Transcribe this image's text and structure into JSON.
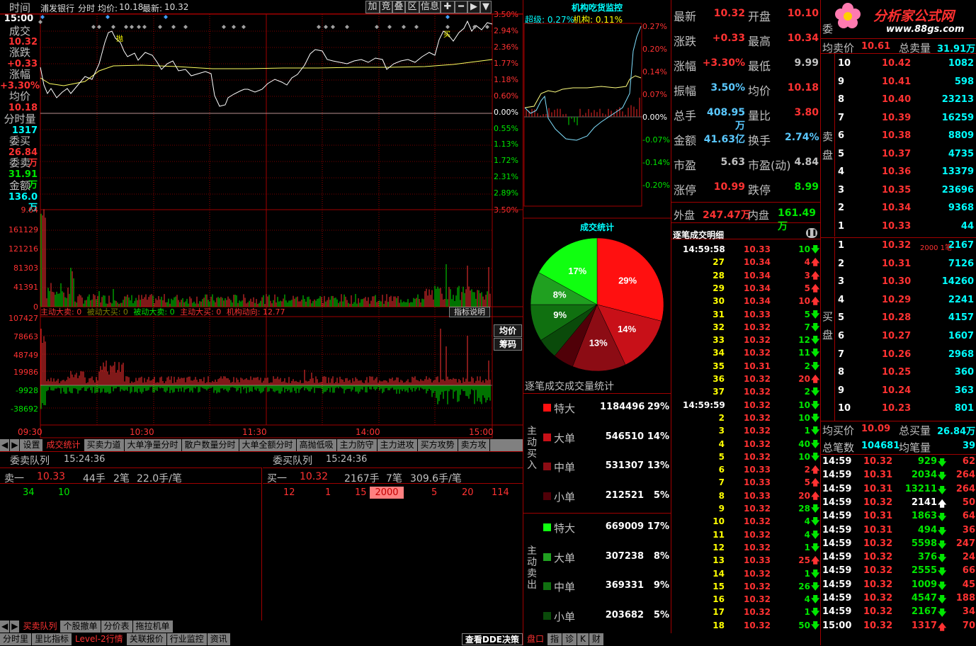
{
  "header": {
    "stock_name": "浦发银行",
    "mode": "分时",
    "avg_label": "均价:",
    "avg_val": "10.18",
    "last_label": "最新:",
    "last_val": "10.32",
    "buttons": [
      "加",
      "叠",
      "叠",
      "区",
      "信息",
      "✚",
      "━",
      "▶",
      "▼"
    ]
  },
  "left_stats": {
    "time_lbl": "时间",
    "time": "15:00",
    "vol_lbl": "成交",
    "vol": "10.32",
    "chg_lbl": "涨跌",
    "chg": "+0.33",
    "pct_lbl": "涨幅",
    "pct": "+3.30%",
    "avg_lbl": "均价",
    "avg": "10.18",
    "fen_lbl": "分时量",
    "fen": "1317",
    "wb_lbl": "委买",
    "wb": "26.84万",
    "ws_lbl": "委卖",
    "ws": "31.91万",
    "amt_lbl": "金额",
    "amt": "136.0万"
  },
  "price_axis": {
    "left": [
      "10.32"
    ],
    "right_red": [
      "3.50%",
      "2.94%",
      "2.36%",
      "1.77%",
      "1.18%",
      "0.60%"
    ],
    "right_zero": "0.00%",
    "right_green": [
      "0.55%",
      "1.13%",
      "1.72%",
      "2.31%",
      "2.89%",
      "3.50%"
    ]
  },
  "vol_axis": [
    "9.64",
    "161129",
    "121216",
    "81303",
    "41391",
    "0"
  ],
  "ind_legend": {
    "a": "主动大卖: 0",
    "b": "被动大买: 0",
    "c": "被动大卖: 0",
    "d": "主动大买: 0",
    "e": "机构动向: 12.77",
    "btn": "指标说明"
  },
  "ind_axis": [
    "107427",
    "78663",
    "48749",
    "19986",
    "-9928",
    "-38692"
  ],
  "side_btns": [
    "均价",
    "筹码"
  ],
  "time_axis": [
    "09:30",
    "10:30",
    "11:30",
    "14:00",
    "15:00"
  ],
  "mid_tabs": [
    "设置",
    "成交统计",
    "买卖力道",
    "大单净量分时",
    "散户数量分时",
    "大单全额分时",
    "高抛低吸",
    "主力防守",
    "主力进攻",
    "买方攻势",
    "卖方攻"
  ],
  "queue": {
    "sell_title": "委卖队列",
    "sell_time": "15:24:36",
    "buy_title": "委买队列",
    "buy_time": "15:24:36",
    "sell_head": [
      "卖一",
      "10.33",
      "44手",
      "2笔",
      "22.0手/笔"
    ],
    "sell_vals": [
      "34",
      "10"
    ],
    "buy_head": [
      "买一",
      "10.32",
      "2167手",
      "7笔",
      "309.6手/笔"
    ],
    "buy_vals": [
      "12",
      "1",
      "15",
      "2000",
      "5",
      "20",
      "114"
    ]
  },
  "bottom_tabs1": [
    "买卖队列",
    "个股撤单",
    "分价表",
    "拖拉机单"
  ],
  "bottom_tabs2": [
    "分时里",
    "里比指标",
    "Level-2行情",
    "关联报价",
    "行业监控",
    "资讯"
  ],
  "dde_btn": "查看DDE决策",
  "inst": {
    "title": "机构吃货监控",
    "sub1": "超级: 0.27%",
    "sub2": "机构: 0.11%",
    "axis": [
      "0.27%",
      "0.20%",
      "0.14%",
      "0.07%",
      "0.00%",
      "-0.07%",
      "-0.14%",
      "-0.20%"
    ]
  },
  "trade_stats": {
    "title": "成交统计",
    "pie": [
      {
        "pct": 29,
        "label": "29%",
        "color": "#ff1010"
      },
      {
        "pct": 14,
        "label": "14%",
        "color": "#c81018"
      },
      {
        "pct": 13,
        "label": "13%",
        "color": "#8c0c14"
      },
      {
        "pct": 5,
        "label": "",
        "color": "#500008"
      },
      {
        "pct": 5,
        "label": "",
        "color": "#0a4a0a"
      },
      {
        "pct": 9,
        "label": "9%",
        "color": "#107010"
      },
      {
        "pct": 8,
        "label": "8%",
        "color": "#20a020"
      },
      {
        "pct": 17,
        "label": "17%",
        "color": "#10ff10"
      }
    ],
    "section": "逐笔成交成交量统计",
    "buy_side": "主动买入",
    "sell_side": "主动卖出",
    "buy_rows": [
      {
        "name": "特大",
        "val": "1184496",
        "pct": "29%",
        "color": "#ff1010"
      },
      {
        "name": "大单",
        "val": "546510",
        "pct": "14%",
        "color": "#c81018"
      },
      {
        "name": "中单",
        "val": "531307",
        "pct": "13%",
        "color": "#8c0c14"
      },
      {
        "name": "小单",
        "val": "212521",
        "pct": "5%",
        "color": "#500008"
      }
    ],
    "sell_rows": [
      {
        "name": "特大",
        "val": "669009",
        "pct": "17%",
        "color": "#10ff10"
      },
      {
        "name": "大单",
        "val": "307238",
        "pct": "8%",
        "color": "#20a020"
      },
      {
        "name": "中单",
        "val": "369331",
        "pct": "9%",
        "color": "#107010"
      },
      {
        "name": "小单",
        "val": "203682",
        "pct": "5%",
        "color": "#0a4a0a"
      }
    ]
  },
  "quote": {
    "rows": [
      [
        "最新",
        "10.32",
        "开盘",
        "10.10"
      ],
      [
        "涨跌",
        "+0.33",
        "最高",
        "10.34"
      ],
      [
        "涨幅",
        "+3.30%",
        "最低",
        "9.99"
      ],
      [
        "振幅",
        "3.50%",
        "均价",
        "10.18"
      ],
      [
        "总手",
        "408.95万",
        "量比",
        "3.80"
      ],
      [
        "金额",
        "41.63亿",
        "换手",
        "2.74%"
      ],
      [
        "市盈",
        "5.63",
        "市盈(动)",
        "4.84"
      ],
      [
        "涨停",
        "10.99",
        "跌停",
        "8.99"
      ]
    ],
    "outer": "外盘",
    "outer_v": "247.47万",
    "inner": "内盘",
    "inner_v": "161.49万"
  },
  "tick_title": "逐笔成交明细",
  "ticks": [
    [
      "14:59:58",
      "10.33",
      "10",
      "d"
    ],
    [
      "27",
      "10.34",
      "4",
      "u"
    ],
    [
      "28",
      "10.34",
      "3",
      "u"
    ],
    [
      "29",
      "10.34",
      "5",
      "u"
    ],
    [
      "30",
      "10.34",
      "10",
      "u"
    ],
    [
      "31",
      "10.33",
      "5",
      "d"
    ],
    [
      "32",
      "10.32",
      "7",
      "d"
    ],
    [
      "33",
      "10.32",
      "12",
      "d"
    ],
    [
      "34",
      "10.32",
      "11",
      "d"
    ],
    [
      "35",
      "10.31",
      "2",
      "d"
    ],
    [
      "36",
      "10.32",
      "20",
      "u"
    ],
    [
      "37",
      "10.32",
      "2",
      "d"
    ],
    [
      "14:59:59",
      "10.32",
      "10",
      "d"
    ],
    [
      "2",
      "10.32",
      "10",
      "d"
    ],
    [
      "3",
      "10.32",
      "1",
      "d"
    ],
    [
      "4",
      "10.32",
      "40",
      "d"
    ],
    [
      "5",
      "10.32",
      "10",
      "d"
    ],
    [
      "6",
      "10.33",
      "2",
      "u"
    ],
    [
      "7",
      "10.33",
      "5",
      "u"
    ],
    [
      "8",
      "10.33",
      "20",
      "u"
    ],
    [
      "9",
      "10.32",
      "28",
      "d"
    ],
    [
      "10",
      "10.32",
      "4",
      "d"
    ],
    [
      "11",
      "10.32",
      "4",
      "d"
    ],
    [
      "12",
      "10.32",
      "1",
      "d"
    ],
    [
      "13",
      "10.33",
      "25",
      "u"
    ],
    [
      "14",
      "10.32",
      "1",
      "d"
    ],
    [
      "15",
      "10.32",
      "26",
      "d"
    ],
    [
      "16",
      "10.32",
      "4",
      "d"
    ],
    [
      "17",
      "10.32",
      "1",
      "d"
    ],
    [
      "18",
      "10.32",
      "50",
      "d"
    ]
  ],
  "book": {
    "ask_title": "委",
    "avg_ask_lbl": "均卖价",
    "avg_ask": "10.61",
    "tot_ask_lbl": "总卖量",
    "tot_ask": "31.91万",
    "sell_side": "卖盘",
    "buy_side": "买盘",
    "asks": [
      [
        "10",
        "10.42",
        "1082"
      ],
      [
        "9",
        "10.41",
        "598"
      ],
      [
        "8",
        "10.40",
        "23213"
      ],
      [
        "7",
        "10.39",
        "16259"
      ],
      [
        "6",
        "10.38",
        "8809"
      ],
      [
        "5",
        "10.37",
        "4735"
      ],
      [
        "4",
        "10.36",
        "13379"
      ],
      [
        "3",
        "10.35",
        "23696"
      ],
      [
        "2",
        "10.34",
        "9368"
      ],
      [
        "1",
        "10.33",
        "44"
      ]
    ],
    "bids": [
      [
        "1",
        "10.32",
        "2167",
        "2000 1笔"
      ],
      [
        "2",
        "10.31",
        "7126",
        ""
      ],
      [
        "3",
        "10.30",
        "14260",
        ""
      ],
      [
        "4",
        "10.29",
        "2241",
        ""
      ],
      [
        "5",
        "10.28",
        "4157",
        ""
      ],
      [
        "6",
        "10.27",
        "1607",
        ""
      ],
      [
        "7",
        "10.26",
        "2968",
        ""
      ],
      [
        "8",
        "10.25",
        "360",
        ""
      ],
      [
        "9",
        "10.24",
        "363",
        ""
      ],
      [
        "10",
        "10.23",
        "801",
        ""
      ]
    ],
    "avg_bid_lbl": "均买价",
    "avg_bid": "10.09",
    "tot_bid_lbl": "总买量",
    "tot_bid": "26.84万",
    "tot_cnt_lbl": "总笔数",
    "tot_cnt": "104681",
    "avg_vol_lbl": "均笔量",
    "avg_vol": "39"
  },
  "trades": [
    [
      "14:59",
      "10.32",
      "929",
      "d",
      "62"
    ],
    [
      "14:59",
      "10.31",
      "2034",
      "d",
      "264"
    ],
    [
      "14:59",
      "10.31",
      "13211",
      "d",
      "264"
    ],
    [
      "14:59",
      "10.32",
      "2141",
      "u",
      "50"
    ],
    [
      "14:59",
      "10.31",
      "1863",
      "d",
      "64"
    ],
    [
      "14:59",
      "10.31",
      "494",
      "d",
      "36"
    ],
    [
      "14:59",
      "10.32",
      "5598",
      "d",
      "247"
    ],
    [
      "14:59",
      "10.32",
      "376",
      "d",
      "24"
    ],
    [
      "14:59",
      "10.32",
      "2555",
      "d",
      "66"
    ],
    [
      "14:59",
      "10.32",
      "1009",
      "d",
      "45"
    ],
    [
      "14:59",
      "10.32",
      "4547",
      "d",
      "188"
    ],
    [
      "14:59",
      "10.32",
      "2167",
      "d",
      "34"
    ],
    [
      "15:00",
      "10.32",
      "1317",
      "u",
      "70"
    ]
  ],
  "right_tabs": [
    "盘口",
    "指",
    "诊",
    "K",
    "财"
  ],
  "logo": {
    "name": "分析家公式网",
    "url": "www.88gs.com"
  }
}
